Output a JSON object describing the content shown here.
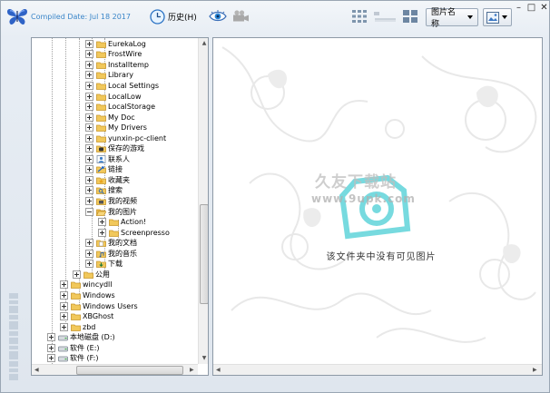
{
  "header": {
    "compiled_date": "Compiled Date: Jul 18 2017",
    "history_label": "历史(H)",
    "sort_label": "图片名称",
    "window_controls": [
      "–",
      "□",
      "✕"
    ]
  },
  "tree": {
    "rows": [
      {
        "label": "EurekaLog",
        "icon": "folder-icon",
        "expander": "plus"
      },
      {
        "label": "FrostWire",
        "icon": "folder-icon",
        "expander": "plus"
      },
      {
        "label": "Installtemp",
        "icon": "folder-icon",
        "expander": "plus"
      },
      {
        "label": "Library",
        "icon": "folder-icon",
        "expander": "plus"
      },
      {
        "label": "Local Settings",
        "icon": "folder-icon",
        "expander": "plus"
      },
      {
        "label": "LocalLow",
        "icon": "folder-icon",
        "expander": "plus"
      },
      {
        "label": "LocalStorage",
        "icon": "folder-icon",
        "expander": "plus"
      },
      {
        "label": "My Doc",
        "icon": "folder-icon",
        "expander": "plus"
      },
      {
        "label": "My Drivers",
        "icon": "folder-icon",
        "expander": "plus"
      },
      {
        "label": "yunxin-pc-client",
        "icon": "folder-icon",
        "expander": "plus"
      },
      {
        "label": "保存的游戏",
        "icon": "saved-games-icon",
        "expander": "plus"
      },
      {
        "label": "联系人",
        "icon": "contacts-icon",
        "expander": "plus"
      },
      {
        "label": "链接",
        "icon": "links-icon",
        "expander": "plus"
      },
      {
        "label": "收藏夹",
        "icon": "favorites-folder-icon",
        "expander": "plus"
      },
      {
        "label": "搜索",
        "icon": "search-folder-icon",
        "expander": "plus"
      },
      {
        "label": "我的视频",
        "icon": "videos-folder-icon",
        "expander": "plus"
      },
      {
        "label": "我的图片",
        "icon": "folder-open-icon",
        "expander": "minus"
      },
      {
        "label": "Action!",
        "icon": "folder-icon",
        "expander": "plus"
      },
      {
        "label": "Screenpresso",
        "icon": "folder-icon",
        "expander": "plus"
      },
      {
        "label": "我的文档",
        "icon": "documents-folder-icon",
        "expander": "plus"
      },
      {
        "label": "我的音乐",
        "icon": "music-folder-icon",
        "expander": "plus"
      },
      {
        "label": "下载",
        "icon": "downloads-folder-icon",
        "expander": "plus"
      },
      {
        "label": "公用",
        "icon": "folder-icon",
        "expander": "plus"
      },
      {
        "label": "wincydll",
        "icon": "folder-icon",
        "expander": "plus"
      },
      {
        "label": "Windows",
        "icon": "folder-icon",
        "expander": "plus"
      },
      {
        "label": "Windows Users",
        "icon": "folder-icon",
        "expander": "plus"
      },
      {
        "label": "XBGhost",
        "icon": "folder-icon",
        "expander": "plus"
      },
      {
        "label": "zbd",
        "icon": "folder-icon",
        "expander": "plus"
      },
      {
        "label": "本地磁盘 (D:)",
        "icon": "drive-icon",
        "expander": "plus"
      },
      {
        "label": "软件 (E:)",
        "icon": "drive-icon",
        "expander": "plus"
      },
      {
        "label": "软件 (F:)",
        "icon": "drive-icon",
        "expander": "plus"
      }
    ]
  },
  "main": {
    "empty_message": "该文件夹中没有可见图片",
    "watermark_text": "久友下载站",
    "watermark_url": "www.9upk.com"
  },
  "colors": {
    "accent": "#3b86c9",
    "watermark_cyan": "#5fd3d9"
  }
}
